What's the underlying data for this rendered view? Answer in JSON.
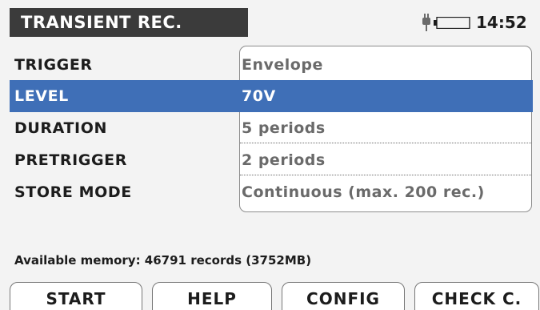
{
  "header": {
    "title": "TRANSIENT REC.",
    "clock": "14:52",
    "plug_icon": "plug-icon",
    "battery_icon": "battery-icon"
  },
  "settings": [
    {
      "label": "TRIGGER",
      "value": "Envelope"
    },
    {
      "label": "LEVEL",
      "value": "70V",
      "selected": true
    },
    {
      "label": "DURATION",
      "value": "5 periods"
    },
    {
      "label": "PRETRIGGER",
      "value": "2 periods"
    },
    {
      "label": "STORE MODE",
      "value": "Continuous (max. 200 rec.)"
    }
  ],
  "status": {
    "available_memory": "Available memory: 46791 records (3752MB)"
  },
  "function_keys": [
    {
      "label": "START"
    },
    {
      "label": "HELP"
    },
    {
      "label": "CONFIG"
    },
    {
      "label": "CHECK C."
    }
  ],
  "colors": {
    "selection": "#3f6fb7",
    "title_background": "#3b3b3b"
  }
}
